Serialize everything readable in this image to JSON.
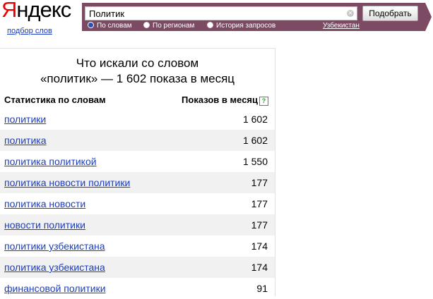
{
  "logo": {
    "part1": "Я",
    "part2": "ндекс"
  },
  "subtitle": "подбор слов",
  "search": {
    "value": "Политик",
    "button": "Подобрать"
  },
  "options": [
    {
      "label": "По словам",
      "selected": true
    },
    {
      "label": "По регионам",
      "selected": false
    },
    {
      "label": "История запросов",
      "selected": false
    }
  ],
  "region": "Узбекистан",
  "heading": {
    "line1": "Что искали со словом",
    "line2": "«политик» — 1 602 показа в месяц"
  },
  "columns": {
    "left": "Статистика по словам",
    "right": "Показов в месяц",
    "help": "?"
  },
  "rows": [
    {
      "keyword": "политики",
      "count": "1 602"
    },
    {
      "keyword": "политика",
      "count": "1 602"
    },
    {
      "keyword": "политика политикой",
      "count": "1 550"
    },
    {
      "keyword": "политика новости политики",
      "count": "177"
    },
    {
      "keyword": "политика новости",
      "count": "177"
    },
    {
      "keyword": "новости политики",
      "count": "177"
    },
    {
      "keyword": "политики узбекистана",
      "count": "174"
    },
    {
      "keyword": "политика узбекистана",
      "count": "174"
    },
    {
      "keyword": "финансовой политики",
      "count": "91"
    }
  ]
}
